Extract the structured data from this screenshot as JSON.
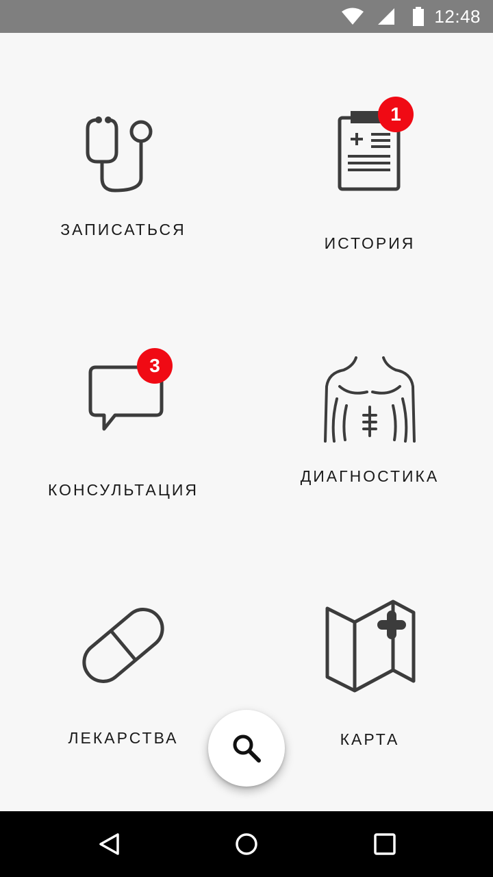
{
  "status_bar": {
    "time": "12:48",
    "icons": [
      "wifi-icon",
      "signal-icon",
      "battery-icon"
    ]
  },
  "menu": {
    "items": [
      {
        "label": "ЗАПИСАТЬСЯ",
        "icon": "stethoscope-icon"
      },
      {
        "label": "ИСТОРИЯ",
        "icon": "medical-record-icon",
        "badge": "1"
      },
      {
        "label": "КОНСУЛЬТАЦИЯ",
        "icon": "chat-bubble-icon",
        "badge": "3"
      },
      {
        "label": "ДИАГНОСТИКА",
        "icon": "body-torso-icon"
      },
      {
        "label": "ЛЕКАРСТВА",
        "icon": "pill-icon"
      },
      {
        "label": "КАРТА",
        "icon": "medical-map-icon"
      }
    ]
  },
  "fab": {
    "icon": "search-icon"
  },
  "nav_bar": {
    "icons": [
      "back-icon",
      "home-icon",
      "recents-icon"
    ]
  },
  "colors": {
    "status_bar": "#7f7f7f",
    "background": "#f7f7f7",
    "badge": "#f00a14",
    "icon_stroke": "#3c3c3c",
    "nav_bar": "#000000"
  }
}
